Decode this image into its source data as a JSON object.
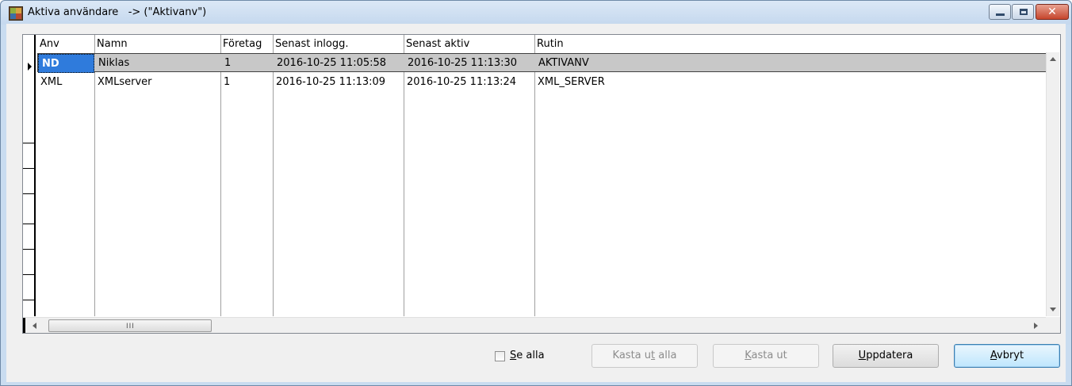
{
  "window": {
    "title": "Aktiva användare   -> (\"Aktivanv\")",
    "icon": "app-icon",
    "controls": {
      "minimize": "minimize-icon",
      "maximize": "maximize-icon",
      "close": "close-icon",
      "close_glyph": "✕"
    }
  },
  "table": {
    "columns": [
      "Anv",
      "Namn",
      "Företag",
      "Senast inlogg.",
      "Senast aktiv",
      "Rutin"
    ],
    "rows": [
      {
        "anv": "ND",
        "namn": "Niklas",
        "foretag": "1",
        "senast_inlogg": "2016-10-25 11:05:58",
        "senast_aktiv": "2016-10-25 11:13:30",
        "rutin": "AKTIVANV"
      },
      {
        "anv": "XML",
        "namn": "XMLserver",
        "foretag": "1",
        "senast_inlogg": "2016-10-25 11:13:09",
        "senast_aktiv": "2016-10-25 11:13:24",
        "rutin": "XML_SERVER"
      }
    ],
    "selected_row": 0,
    "hscroll_grip": "III"
  },
  "footer": {
    "checkbox_label_acc": "S",
    "checkbox_label_rest": "e alla",
    "checkbox_checked": false,
    "buttons": {
      "kasta_ut_alla_a": "Kasta u",
      "kasta_ut_alla_acc": "t",
      "kasta_ut_alla_b": " alla",
      "kasta_ut_acc": "K",
      "kasta_ut_rest": "asta ut",
      "uppdatera_acc": "U",
      "uppdatera_rest": "ppdatera",
      "avbryt_acc": "A",
      "avbryt_rest": "vbryt"
    }
  },
  "colors": {
    "selection": "#2f7bdc",
    "selected_row": "#c8c8c8",
    "titlebar": "#c5d8ee"
  }
}
